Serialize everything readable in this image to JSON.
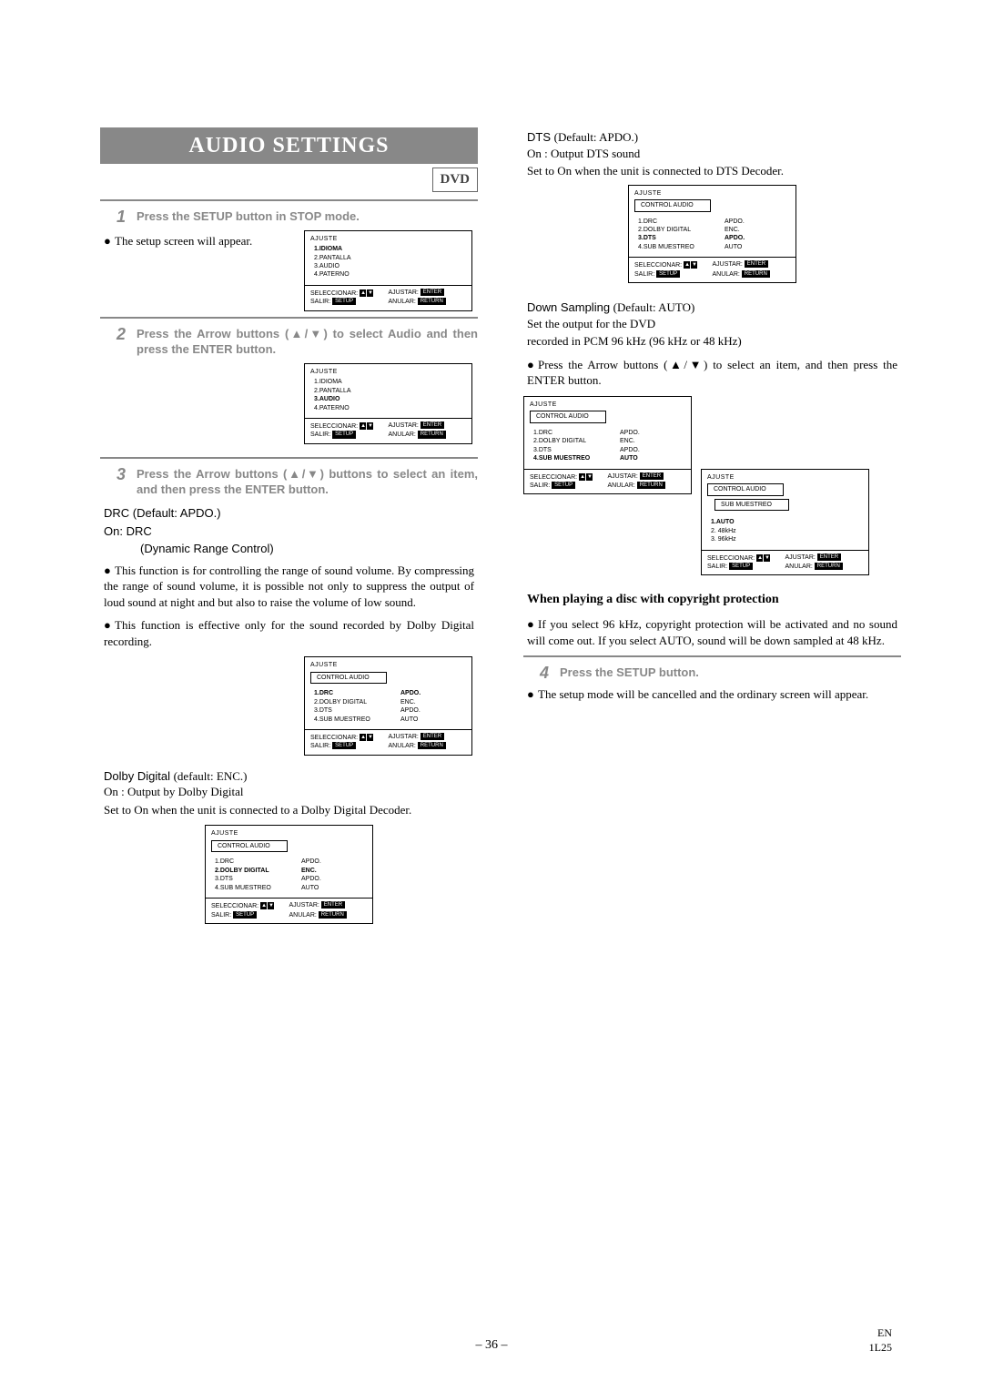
{
  "title_band": "AUDIO SETTINGS",
  "dvd_badge": "DVD",
  "steps": {
    "s1": {
      "num": "1",
      "text": "Press the SETUP button in STOP mode."
    },
    "s2": {
      "num": "2",
      "text": "Press the Arrow buttons (▲/▼) to select Audio and then press the ENTER button."
    },
    "s3": {
      "num": "3",
      "text": "Press the Arrow buttons (▲/▼) buttons to select an item, and then press the ENTER button."
    },
    "s4": {
      "num": "4",
      "text": "Press the SETUP button."
    }
  },
  "phrases": {
    "setup_appear": "The setup screen will appear.",
    "drc_head": "DRC (Default: APDO.)",
    "drc_on": "On: DRC",
    "drc_sub": "(Dynamic Range Control)",
    "drc_p1": "This function is for controlling the range of sound volume. By compressing the range of sound volume, it is possible not only to suppress the output of loud sound at night and but also to raise the volume of low sound.",
    "drc_p2": "This function is effective only for the sound recorded by Dolby Digital recording.",
    "dd_head": "Dolby Digital ",
    "dd_head_tail": "(default: ENC.)",
    "dolby_on": "On : Output by Dolby Digital",
    "dolby_p": "Set to On when the unit is connected to a Dolby Digital Decoder.",
    "dts_head": "DTS ",
    "dts_head_tail": "(Default: APDO.)",
    "dts_on": "On : Output DTS sound",
    "dts_p": "Set to On when the unit is connected to DTS Decoder.",
    "ds_head": "Down Sampling ",
    "ds_head_tail": "(Default: AUTO)",
    "ds_p1": "Set the output for the DVD",
    "ds_p2": "recorded in PCM 96 kHz (96 kHz or 48 kHz)",
    "ds_arrow": "Press the Arrow buttons (▲/▼) to select an item, and then press the ENTER button.",
    "cp_head": "When playing a disc with copyright  protection",
    "cp_p": "If you select 96 kHz, copyright protection will be activated and no sound will come out. If you select AUTO, sound will be down sampled at 48 kHz.",
    "end_p": "The setup mode will be cancelled and the ordinary screen will appear."
  },
  "osd": {
    "title_main": "AJUSTE",
    "sub_control": "CONTROL AUDIO",
    "sub_submu": "SUB MUESTREO",
    "main_items": {
      "i1": "1.IDIOMA",
      "i2": "2.PANTALLA",
      "i3": "3.AUDIO",
      "i4": "4.PATERNO"
    },
    "audio_items": {
      "r1l": "1.DRC",
      "r1r": "APDO.",
      "r2l": "2.DOLBY DIGITAL",
      "r2r": "ENC.",
      "r3l": "3.DTS",
      "r3r": "APDO.",
      "r4l": "4.SUB MUESTREO",
      "r4r": "AUTO"
    },
    "subm_items": {
      "i1": "1.AUTO",
      "i2": "2. 48kHz",
      "i3": "3. 96kHz"
    },
    "footer": {
      "sel": "SELECCIONAR:",
      "aj": "AJUSTAR:",
      "aj_btn": "ENTER",
      "sal": "SALIR:",
      "sal_btn": "SETUP",
      "an": "ANULAR:",
      "an_btn": "RETURN"
    }
  },
  "page_num": "– 36 –",
  "doc_code": {
    "a": "EN",
    "b": "1L25"
  }
}
